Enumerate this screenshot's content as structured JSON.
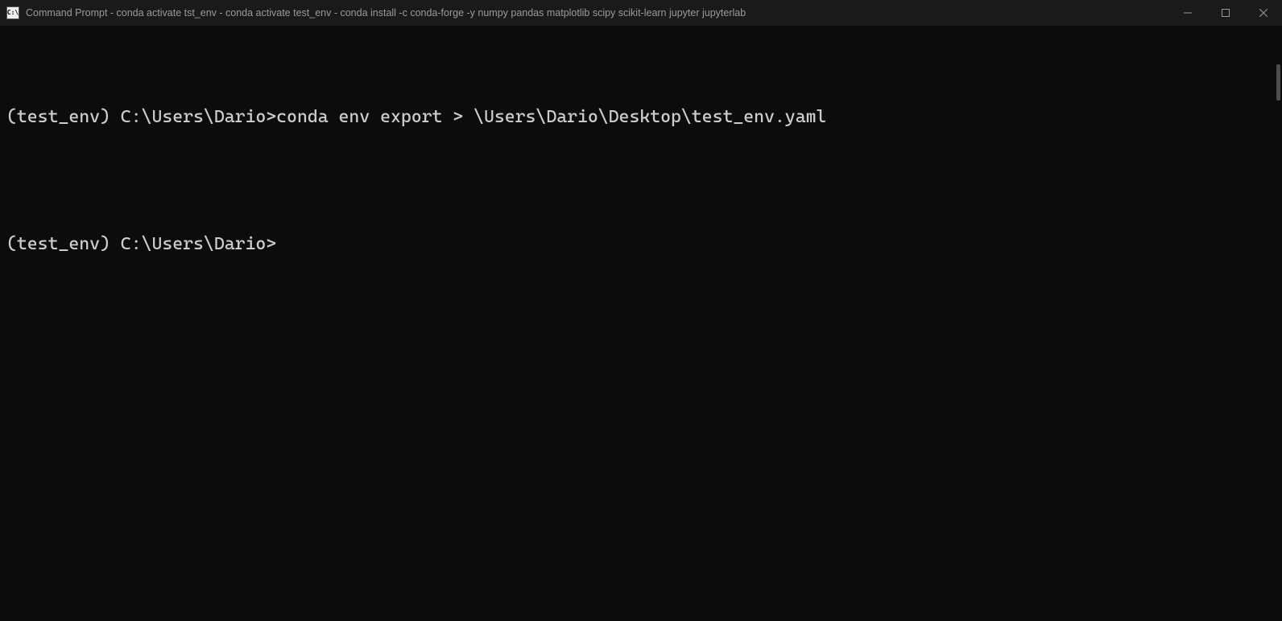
{
  "window": {
    "title": "Command Prompt - conda  activate tst_env - conda  activate test_env - conda  install -c conda-forge -y numpy pandas matplotlib scipy scikit-learn jupyter jupyterlab"
  },
  "terminal": {
    "lines": [
      "(test_env) C:\\Users\\Dario>conda env export > \\Users\\Dario\\Desktop\\test_env.yaml",
      "",
      "(test_env) C:\\Users\\Dario>"
    ]
  }
}
